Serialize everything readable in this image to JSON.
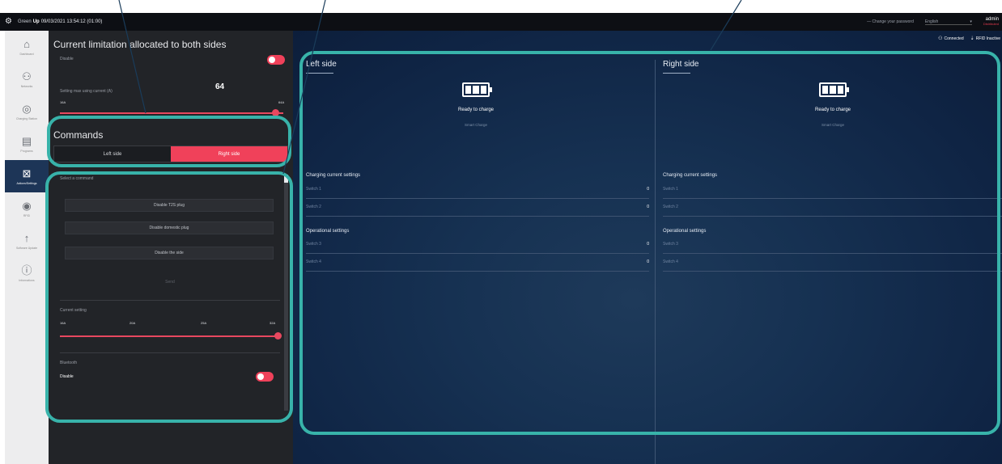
{
  "topbar": {
    "brand_prefix": "Green",
    "brand_bold": "Up",
    "timestamp": "09/03/2021 13:54:12 (01:00)",
    "change_password": "Change your password",
    "language": "English",
    "user": "admin",
    "user_role": "Distributed"
  },
  "rail": {
    "items": [
      {
        "label": "Dashboard",
        "icon": "home-icon"
      },
      {
        "label": "Networks",
        "icon": "network-icon"
      },
      {
        "label": "Charging Station",
        "icon": "station-icon"
      },
      {
        "label": "Programs",
        "icon": "program-icon"
      },
      {
        "label": "Actions/Settings",
        "icon": "settings-icon",
        "active": true
      },
      {
        "label": "RFID",
        "icon": "rfid-icon"
      },
      {
        "label": "Software Update",
        "icon": "upload-icon"
      },
      {
        "label": "Informations",
        "icon": "info-icon"
      }
    ]
  },
  "panel": {
    "title": "Current limitation allocated to both sides",
    "disable_label": "Disable",
    "setting_label": "Setting max using current (A)",
    "setting_value": "64",
    "range_min": "16A",
    "range_max": "64A",
    "commands_title": "Commands",
    "seg_left": "Left side",
    "seg_right": "Right side",
    "select_command": "Select a command",
    "cmd1": "Disable T2S plug",
    "cmd2": "Disable domestic plug",
    "cmd3": "Disable the side",
    "send": "Send",
    "current_setting": "Current setting",
    "ticks": [
      "16A",
      "20A",
      "25A",
      "32A"
    ],
    "bluetooth": "Bluetooth",
    "bt_disable": "Disable"
  },
  "main": {
    "connected": "Connected",
    "rfid": "RFID Inactive",
    "left": {
      "title": "Left side",
      "status": "Ready to charge",
      "mode": "Smart Charge",
      "charging_title": "Charging current settings",
      "operational_title": "Operational settings",
      "rows1": [
        {
          "name": "Switch 1",
          "value": "0"
        },
        {
          "name": "Switch 2",
          "value": "0"
        }
      ],
      "rows2": [
        {
          "name": "Switch 3",
          "value": "0"
        },
        {
          "name": "Switch 4",
          "value": "0"
        }
      ]
    },
    "right": {
      "title": "Right side",
      "status": "Ready to charge",
      "mode": "Smart Charge",
      "charging_title": "Charging current settings",
      "operational_title": "Operational settings",
      "rows1": [
        {
          "name": "Switch 1",
          "value": ""
        },
        {
          "name": "Switch 2",
          "value": ""
        }
      ],
      "rows2": [
        {
          "name": "Switch 3",
          "value": ""
        },
        {
          "name": "Switch 4",
          "value": ""
        }
      ]
    }
  },
  "colors": {
    "accent": "#f0415a",
    "teal": "#38b3aa",
    "navy": "#0f2444"
  }
}
